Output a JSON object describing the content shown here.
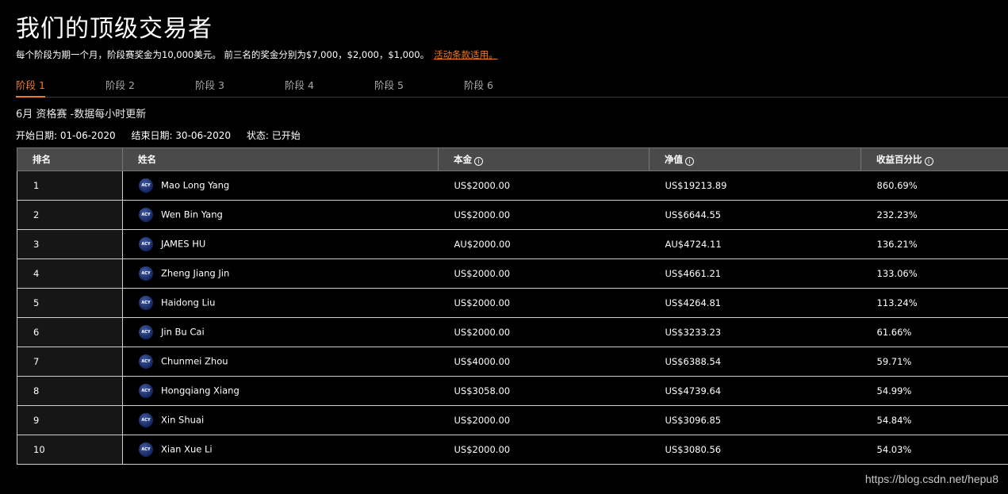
{
  "header": {
    "title": "我们的顶级交易者",
    "description": "每个阶段为期一个月，阶段赛奖金为10,000美元。 前三名的奖金分别为$7,000，$2,000，$1,000。",
    "terms_link": "活动条款适用。"
  },
  "tabs": [
    {
      "label": "阶段 1",
      "active": true
    },
    {
      "label": "阶段 2",
      "active": false
    },
    {
      "label": "阶段 3",
      "active": false
    },
    {
      "label": "阶段 4",
      "active": false
    },
    {
      "label": "阶段 5",
      "active": false
    },
    {
      "label": "阶段 6",
      "active": false
    }
  ],
  "stage": {
    "subtitle": "6月 资格赛 -数据每小时更新",
    "start_date": "开始日期: 01-06-2020",
    "end_date": "结束日期: 30-06-2020",
    "status": "状态: 已开始"
  },
  "table": {
    "headers": {
      "rank": "排名",
      "name": "姓名",
      "principal": "本金",
      "equity": "净值",
      "return": "收益百分比"
    },
    "info_icon": "i",
    "avatar_text": "ACY",
    "rows": [
      {
        "rank": "1",
        "name": "Mao Long Yang",
        "principal": "US$2000.00",
        "equity": "US$19213.89",
        "return": "860.69%"
      },
      {
        "rank": "2",
        "name": "Wen Bin Yang",
        "principal": "US$2000.00",
        "equity": "US$6644.55",
        "return": "232.23%"
      },
      {
        "rank": "3",
        "name": "JAMES HU",
        "principal": "AU$2000.00",
        "equity": "AU$4724.11",
        "return": "136.21%"
      },
      {
        "rank": "4",
        "name": "Zheng Jiang Jin",
        "principal": "US$2000.00",
        "equity": "US$4661.21",
        "return": "133.06%"
      },
      {
        "rank": "5",
        "name": "Haidong Liu",
        "principal": "US$2000.00",
        "equity": "US$4264.81",
        "return": "113.24%"
      },
      {
        "rank": "6",
        "name": "Jin Bu Cai",
        "principal": "US$2000.00",
        "equity": "US$3233.23",
        "return": "61.66%"
      },
      {
        "rank": "7",
        "name": "Chunmei Zhou",
        "principal": "US$4000.00",
        "equity": "US$6388.54",
        "return": "59.71%"
      },
      {
        "rank": "8",
        "name": "Hongqiang Xiang",
        "principal": "US$3058.00",
        "equity": "US$4739.64",
        "return": "54.99%"
      },
      {
        "rank": "9",
        "name": "Xin Shuai",
        "principal": "US$2000.00",
        "equity": "US$3096.85",
        "return": "54.84%"
      },
      {
        "rank": "10",
        "name": "Xian Xue Li",
        "principal": "US$2000.00",
        "equity": "US$3080.56",
        "return": "54.03%"
      }
    ]
  },
  "watermark": "https://blog.csdn.net/hepu8",
  "colors": {
    "accent": "#f07b22",
    "header_bg": "#4a4a4a",
    "background": "#000000"
  }
}
